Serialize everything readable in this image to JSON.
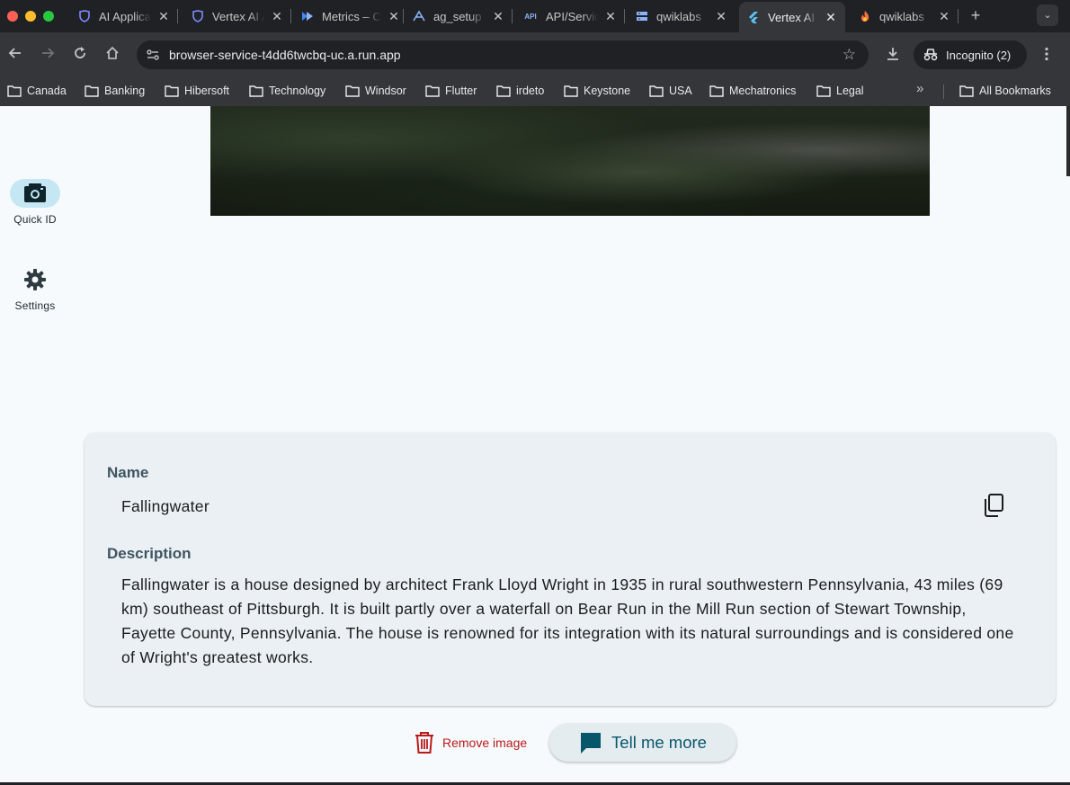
{
  "browser": {
    "tabs": [
      {
        "title": "AI Applications",
        "icon": "shield-icon",
        "color": "#7b8cff"
      },
      {
        "title": "Vertex AI Agent Builder",
        "icon": "shield-icon",
        "color": "#7b8cff"
      },
      {
        "title": "Metrics – Cloud Run",
        "icon": "cloud-run-icon",
        "color": "#8ab4f8"
      },
      {
        "title": "ag_setup",
        "icon": "agent-icon",
        "color": "#8ab4f8"
      },
      {
        "title": "API/Service Details",
        "icon": "api-icon",
        "color": "#8ab4f8"
      },
      {
        "title": "qwiklabs",
        "icon": "storage-icon",
        "color": "#8ab4f8"
      },
      {
        "title": "Vertex AI",
        "icon": "flutter-icon",
        "color": "#5cc4f5",
        "active": true
      },
      {
        "title": "qwiklabs",
        "icon": "firebase-icon",
        "color": "#ffa000"
      }
    ],
    "url": "browser-service-t4dd6twcbq-uc.a.run.app",
    "incognito_label": "Incognito (2)",
    "bookmarks": [
      "Canada",
      "Banking",
      "Hibersoft",
      "Technology",
      "Windsor",
      "Flutter",
      "irdeto",
      "Keystone",
      "USA",
      "Mechatronics",
      "Legal"
    ],
    "all_bookmarks": "All Bookmarks"
  },
  "rail": {
    "items": [
      {
        "label": "Quick ID",
        "icon": "camera-icon",
        "active": true
      },
      {
        "label": "Settings",
        "icon": "gear-icon",
        "active": false
      }
    ]
  },
  "result": {
    "name_label": "Name",
    "name_value": "Fallingwater",
    "description_label": "Description",
    "description_value": "Fallingwater is a house designed by architect Frank Lloyd Wright in 1935 in rural southwestern Pennsylvania, 43 miles (69 km) southeast of Pittsburgh. It is built partly over a waterfall on Bear Run in the Mill Run section of Stewart Township, Fayette County, Pennsylvania. The house is renowned for its integration with its natural surroundings and is considered one of Wright's greatest works."
  },
  "actions": {
    "remove_label": "Remove image",
    "more_label": "Tell me more"
  },
  "colors": {
    "accent": "#07576b",
    "danger": "#ba1a1a",
    "rail_active": "#c4e7f3",
    "page_bg": "#f6fafd",
    "card_bg": "#eaf0f4"
  }
}
